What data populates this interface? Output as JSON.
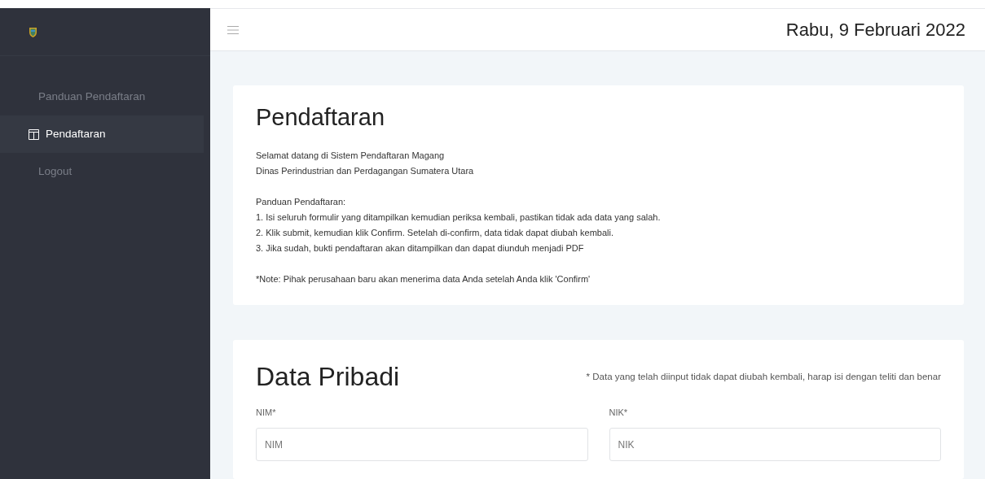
{
  "sidebar": {
    "items": [
      {
        "label": "Panduan Pendaftaran",
        "selected": false,
        "icon": false
      },
      {
        "label": "Pendaftaran",
        "selected": true,
        "icon": true
      },
      {
        "label": "Logout",
        "selected": false,
        "icon": false
      }
    ]
  },
  "header": {
    "date": "Rabu, 9 Februari 2022"
  },
  "intro_card": {
    "title": "Pendaftaran",
    "paragraphs": [
      [
        "Selamat datang di Sistem Pendaftaran Magang",
        "Dinas Perindustrian dan Perdagangan Sumatera Utara"
      ],
      [
        "Panduan Pendaftaran:",
        "1. Isi seluruh formulir yang ditampilkan kemudian periksa kembali, pastikan tidak ada data yang salah.",
        "2. Klik submit, kemudian klik Confirm. Setelah di-confirm, data tidak dapat diubah kembali.",
        "3. Jika sudah, bukti pendaftaran akan ditampilkan dan dapat diunduh menjadi PDF"
      ],
      [
        "*Note: Pihak perusahaan baru akan menerima data Anda setelah Anda klik 'Confirm'"
      ]
    ]
  },
  "form_card": {
    "title": "Data Pribadi",
    "notice": "* Data yang telah diinput tidak dapat diubah kembali, harap isi dengan teliti dan benar",
    "fields": [
      {
        "label": "NIM*",
        "placeholder": "NIM"
      },
      {
        "label": "NIK*",
        "placeholder": "NIK"
      }
    ]
  }
}
